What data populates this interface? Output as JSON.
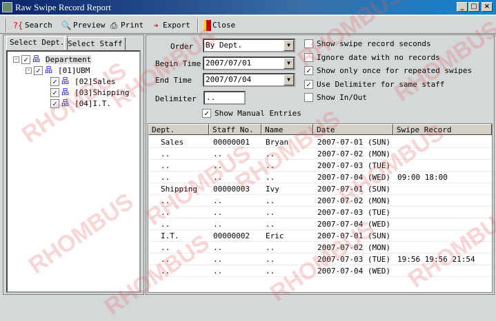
{
  "window": {
    "title": "Raw Swipe Record Report",
    "minimize": "_",
    "maximize": "□",
    "close": "×"
  },
  "toolbar": {
    "search": "Search",
    "preview": "Preview",
    "print": "Print",
    "export": "Export",
    "close": "Close"
  },
  "tabs": [
    "Select Dept.",
    "Select Staff"
  ],
  "tree": [
    {
      "label": "Department",
      "level": 0,
      "checked": true,
      "expander": "-"
    },
    {
      "label": "[01]UBM",
      "level": 1,
      "checked": true,
      "expander": "-"
    },
    {
      "label": "[02]Sales",
      "level": 2,
      "checked": true
    },
    {
      "label": "[03]Shipping",
      "level": 2,
      "checked": true
    },
    {
      "label": "[04]I.T.",
      "level": 2,
      "checked": true
    }
  ],
  "form": {
    "order_label": "Order",
    "order_value": "By Dept.",
    "begin_label": "Begin Time",
    "begin_value": "2007/07/01",
    "end_label": "End Time",
    "end_value": "2007/07/04",
    "delimiter_label": "Delimiter",
    "delimiter_value": "..",
    "manual_entries": {
      "label": "Show Manual Entries",
      "checked": true
    }
  },
  "options": [
    {
      "label": "Show swipe record seconds",
      "checked": false
    },
    {
      "label": "Ignore date with no records",
      "checked": false
    },
    {
      "label": "Show only once for repeated swipes",
      "checked": true
    },
    {
      "label": "Use Delimiter for same staff",
      "checked": true
    },
    {
      "label": "Show In/Out",
      "checked": false
    }
  ],
  "table": {
    "columns": [
      "Dept.",
      "Staff No.",
      "Name",
      "Date",
      "Swipe Record"
    ],
    "rows": [
      [
        "Sales",
        "00000001",
        "Bryan",
        "2007-07-01 (SUN)",
        ""
      ],
      [
        "..",
        "..",
        "..",
        "2007-07-02 (MON)",
        ""
      ],
      [
        "..",
        "..",
        "..",
        "2007-07-03 (TUE)",
        ""
      ],
      [
        "..",
        "..",
        "..",
        "2007-07-04 (WED)",
        "09:00 18:00"
      ],
      [
        "Shipping",
        "00000003",
        "Ivy",
        "2007-07-01 (SUN)",
        ""
      ],
      [
        "..",
        "..",
        "..",
        "2007-07-02 (MON)",
        ""
      ],
      [
        "..",
        "..",
        "..",
        "2007-07-03 (TUE)",
        ""
      ],
      [
        "..",
        "..",
        "..",
        "2007-07-04 (WED)",
        ""
      ],
      [
        "I.T.",
        "00000002",
        "Eric",
        "2007-07-01 (SUN)",
        ""
      ],
      [
        "..",
        "..",
        "..",
        "2007-07-02 (MON)",
        ""
      ],
      [
        "..",
        "..",
        "..",
        "2007-07-03 (TUE)",
        "19:56 19:56 21:54"
      ],
      [
        "..",
        "..",
        "..",
        "2007-07-04 (WED)",
        ""
      ]
    ]
  },
  "watermark": "RHOMBUS"
}
